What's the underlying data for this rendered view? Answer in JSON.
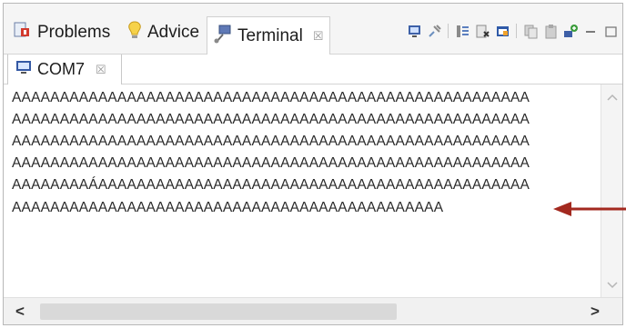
{
  "view_tabs": {
    "problems": {
      "label": "Problems",
      "icon": "problems-icon"
    },
    "advice": {
      "label": "Advice",
      "icon": "lightbulb-icon"
    },
    "terminal": {
      "label": "Terminal",
      "icon": "terminal-icon",
      "close": "☒"
    }
  },
  "toolbar": {
    "buttons": [
      "display-icon",
      "pin-icon",
      "scroll-lock-icon",
      "clear-icon",
      "new-window-icon",
      "copy-icon",
      "paste-icon",
      "settings-icon",
      "minimize-icon",
      "maximize-icon"
    ]
  },
  "inner_tab": {
    "label": "COM7",
    "icon": "monitor-icon",
    "close": "☒"
  },
  "console": {
    "lines": [
      "AAAAAAAAAAAAAAAAAAAAAAAAAAAAAAAAAAAAAAAAAAAAAAAAAAAAAA",
      "AAAAAAAAAAAAAAAAAAAAAAAAAAAAAAAAAAAAAAAAAAAAAAAAAAAAAA",
      "AAAAAAAAAAAAAAAAAAAAAAAAAAAAAAAAAAAAAAAAAAAAAAAAAAAAAA",
      "AAAAAAAAAAAAAAAAAAAAAAAAAAAAAAAAAAAAAAAAAAAAAAAAAAAAAA",
      "AAAAAAAAÁAAAAAAAAAAAAAAAAAAAAAAAAAAAAAAAAAAAAAAAAAAAAA",
      "AAAAAAAAAAAAAAAAAAAAAAAAAAAAAAAAAAAAAAAAAAAAA"
    ]
  },
  "scrollbars": {
    "left": "<",
    "right": ">",
    "up": "^",
    "down": "v"
  },
  "annotation": {
    "arrow_color": "#a3291f"
  }
}
